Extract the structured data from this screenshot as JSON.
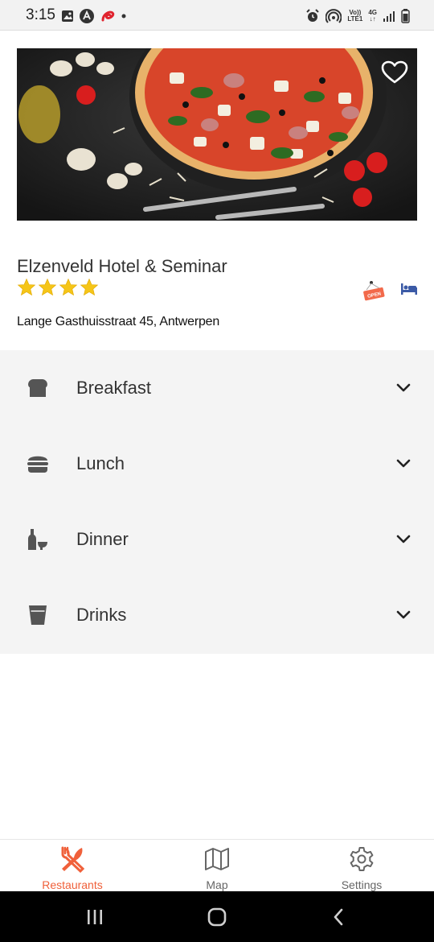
{
  "status_bar": {
    "time": "3:15",
    "network_top": "Vo))",
    "network_bottom": "LTE1",
    "signal_type": "4G",
    "left_icons": [
      "image-icon",
      "app-a-icon",
      "airtel-icon",
      "notification-dot"
    ],
    "right_icons": [
      "alarm-icon",
      "hotspot-icon",
      "signal-icon",
      "battery-icon"
    ]
  },
  "hotel": {
    "name": "Elzenveld Hotel & Seminar",
    "stars": 4,
    "address": "Lange Gasthuisstraat 45, Antwerpen",
    "open_badge_text": "OPEN",
    "image_description_icon": "pizza-photo"
  },
  "menu": {
    "items": [
      {
        "label": "Breakfast",
        "icon": "bread-icon"
      },
      {
        "label": "Lunch",
        "icon": "burger-icon"
      },
      {
        "label": "Dinner",
        "icon": "wine-bottle-glass-icon"
      },
      {
        "label": "Drinks",
        "icon": "cup-icon"
      }
    ]
  },
  "bottom_nav": {
    "tabs": [
      {
        "label": "Restaurants",
        "icon": "utensils-icon",
        "active": true
      },
      {
        "label": "Map",
        "icon": "map-icon",
        "active": false
      },
      {
        "label": "Settings",
        "icon": "gear-icon",
        "active": false
      }
    ]
  },
  "colors": {
    "accent": "#f0603a",
    "inactive": "#666666",
    "star": "#f5c518",
    "menu_bg": "#f4f4f4",
    "bed_icon": "#3b5aa6"
  }
}
